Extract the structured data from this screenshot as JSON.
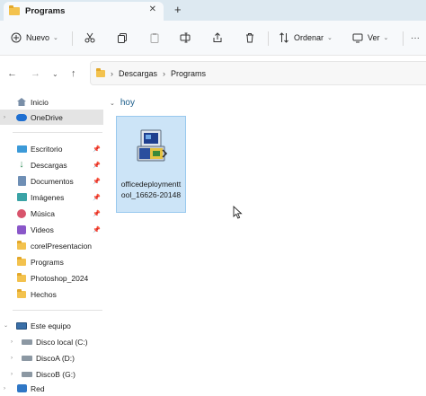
{
  "tab": {
    "title": "Programs",
    "close": "✕",
    "add": "+"
  },
  "toolbar": {
    "new_label": "Nuevo",
    "sort_label": "Ordenar",
    "view_label": "Ver",
    "more": "···"
  },
  "address": {
    "segments": [
      "Descargas",
      "Programs"
    ]
  },
  "sidebar": {
    "quick": [
      {
        "label": "Inicio",
        "icon": "home-icon"
      },
      {
        "label": "OneDrive",
        "icon": "onedrive-icon",
        "selected": true
      }
    ],
    "pinned": [
      {
        "label": "Escritorio",
        "icon": "desktop-icon"
      },
      {
        "label": "Descargas",
        "icon": "downloads-icon"
      },
      {
        "label": "Documentos",
        "icon": "documents-icon"
      },
      {
        "label": "Imágenes",
        "icon": "pictures-icon"
      },
      {
        "label": "Música",
        "icon": "music-icon"
      },
      {
        "label": "Videos",
        "icon": "videos-icon"
      }
    ],
    "folders": [
      {
        "label": "corelPresentacion",
        "icon": "folder-icon"
      },
      {
        "label": "Programs",
        "icon": "folder-icon"
      },
      {
        "label": "Photoshop_2024",
        "icon": "folder-icon"
      },
      {
        "label": "Hechos",
        "icon": "folder-icon"
      }
    ],
    "devices": [
      {
        "label": "Este equipo",
        "icon": "this-pc-icon"
      },
      {
        "label": "Disco local (C:)",
        "icon": "drive-icon"
      },
      {
        "label": "DiscoA (D:)",
        "icon": "drive-icon"
      },
      {
        "label": "DiscoB (G:)",
        "icon": "drive-icon"
      },
      {
        "label": "Red",
        "icon": "network-icon"
      }
    ]
  },
  "content": {
    "group_label": "hoy",
    "file": {
      "name": "officedeploymenttool_16626-20148"
    }
  }
}
